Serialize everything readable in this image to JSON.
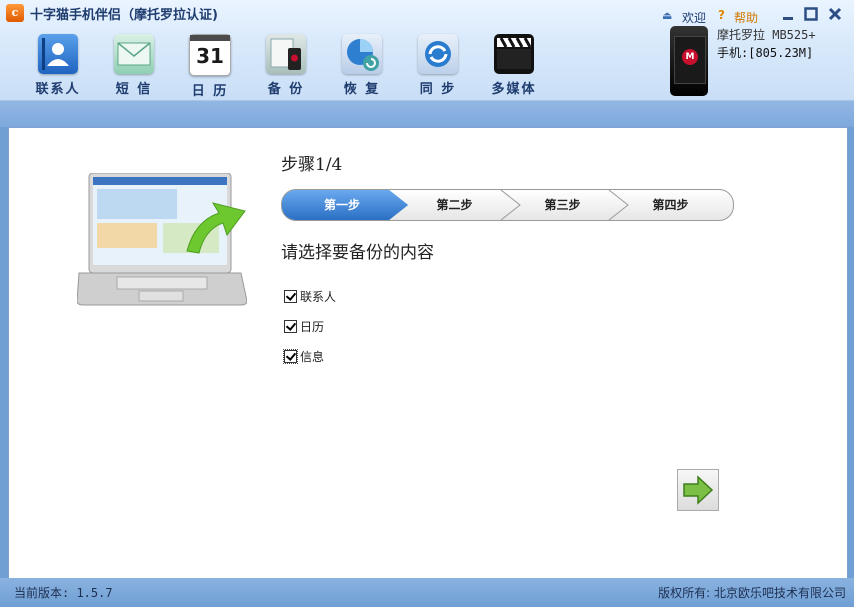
{
  "app": {
    "title": "十字猫手机伴侣（摩托罗拉认证)",
    "logo_text": "c"
  },
  "top_links": {
    "welcome": "欢迎",
    "help": "帮助"
  },
  "nav": [
    {
      "label": "联系人",
      "icon": "contacts-icon"
    },
    {
      "label": "短 信",
      "icon": "sms-envelope-icon"
    },
    {
      "label": "日 历",
      "icon": "calendar-icon",
      "icon_text": "31"
    },
    {
      "label": "备 份",
      "icon": "backup-icon"
    },
    {
      "label": "恢 复",
      "icon": "restore-icon"
    },
    {
      "label": "同 步",
      "icon": "sync-icon"
    },
    {
      "label": "多媒体",
      "icon": "multimedia-clapper-icon"
    }
  ],
  "device": {
    "model": "摩托罗拉 MB525+",
    "memory": "手机:[805.23M]"
  },
  "wizard": {
    "step_title": "步骤1/4",
    "steps": [
      "第一步",
      "第二步",
      "第三步",
      "第四步"
    ],
    "active_step": 1,
    "prompt": "请选择要备份的内容",
    "options": [
      {
        "label": "联系人",
        "checked": true
      },
      {
        "label": "日历",
        "checked": true
      },
      {
        "label": "信息",
        "checked": true
      }
    ]
  },
  "status": {
    "version": "当前版本: 1.5.7",
    "copyright": "版权所有: 北京欧乐吧技术有限公司"
  },
  "colors": {
    "accent": "#3b7fd4",
    "title_text": "#1e3c6e",
    "arrow_green": "#6fb23a"
  }
}
